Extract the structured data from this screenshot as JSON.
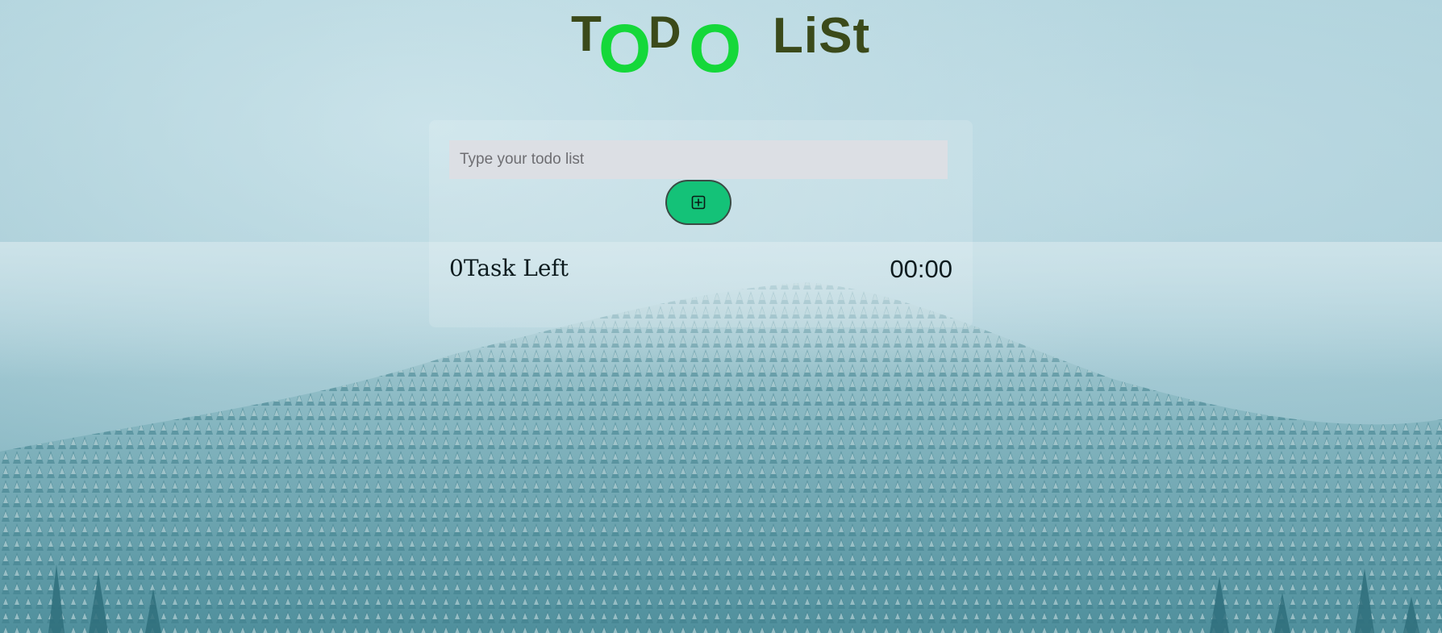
{
  "header": {
    "title_letters": [
      "T",
      "O",
      "D",
      "O",
      "LiSt"
    ]
  },
  "todo": {
    "input_placeholder": "Type your todo list",
    "input_value": "",
    "add_button_icon": "plus-square-icon",
    "tasks_left": "0Task Left",
    "timer": "00:00"
  },
  "colors": {
    "title_dark": "#3b4a1a",
    "title_green": "#15d83a",
    "add_button": "#14c278",
    "input_bg": "#dcdfe4"
  },
  "background": {
    "scene": "foggy snowy forested mountain"
  }
}
